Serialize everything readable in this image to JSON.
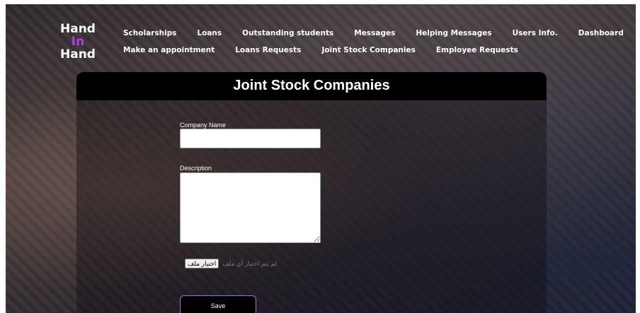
{
  "brand": {
    "line1": "Hand",
    "line2": "In",
    "line3": "Hand",
    "accent_color": "#b041e8"
  },
  "nav": {
    "row1": [
      "Scholarships",
      "Loans",
      "Outstanding students",
      "Messages",
      "Helping Messages",
      "Users Info.",
      "Dashboard"
    ],
    "row2": [
      "Make an appointment",
      "Loans Requests",
      "Joint Stock Companies",
      "Employee Requests"
    ]
  },
  "form": {
    "title": "Joint Stock Companies",
    "company_name_label": "Company Name",
    "company_name_value": "",
    "description_label": "Description",
    "description_value": "",
    "file_button_label": "اختيار ملف",
    "file_status": "لم يتم اختيار أي ملف",
    "save_label": "Save"
  }
}
